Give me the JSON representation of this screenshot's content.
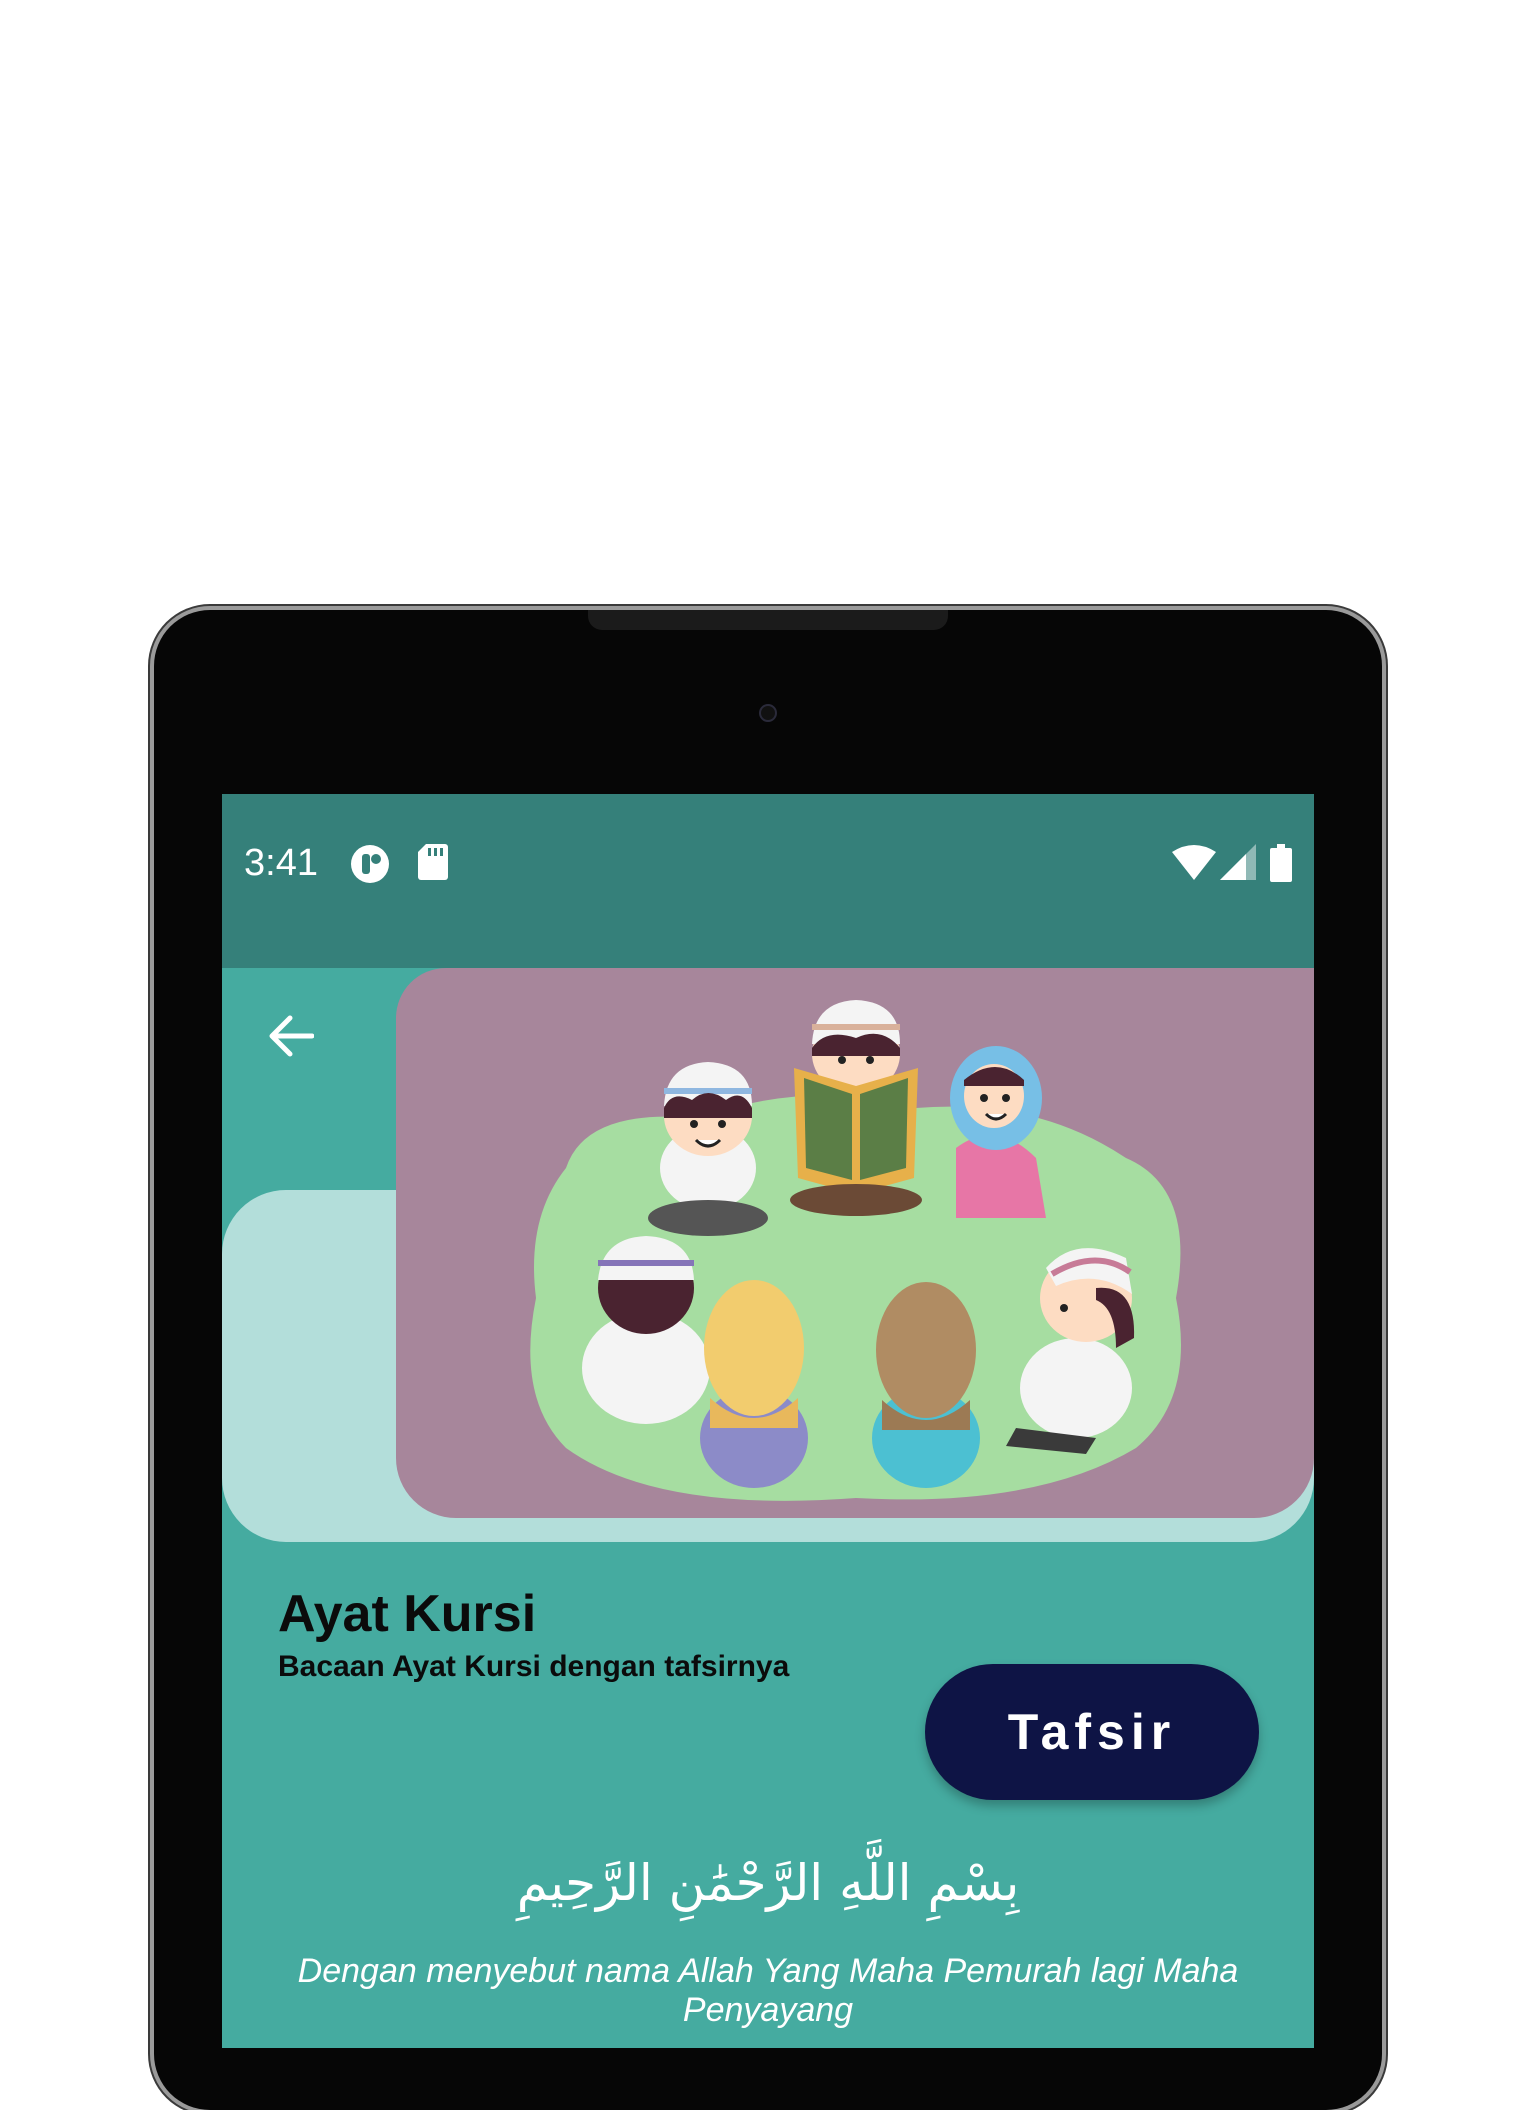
{
  "status_bar": {
    "time": "3:41",
    "icons": [
      "app-notification-icon",
      "sd-card-icon",
      "wifi-icon",
      "signal-icon",
      "battery-icon"
    ]
  },
  "header": {
    "back_icon": "arrow-left-icon",
    "illustration": "children-reading-quran-illustration"
  },
  "content": {
    "title": "Ayat Kursi",
    "subtitle": "Bacaan Ayat Kursi dengan tafsirnya",
    "tafsir_button": "Tafsir",
    "arabic_text": "بِسْمِ اللَّهِ الرَّحْمَٰنِ الرَّحِيمِ",
    "translation": "Dengan menyebut nama Allah Yang Maha Pemurah lagi Maha Penyayang"
  },
  "colors": {
    "status_bar": "#35807A",
    "background": "#45ABA0",
    "card": "#B3DEDA",
    "hero": "#A7869B",
    "button": "#0E1445"
  }
}
